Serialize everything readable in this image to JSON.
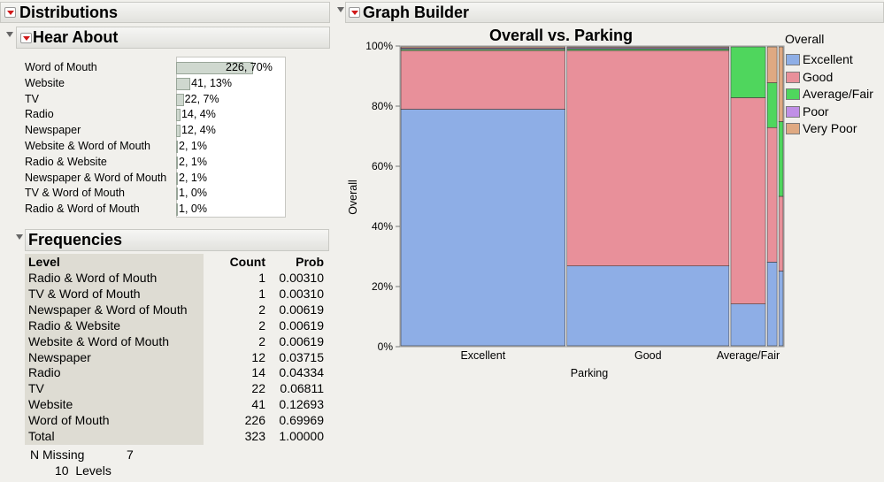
{
  "distributions": {
    "title": "Distributions"
  },
  "hear_about": {
    "title": "Hear About",
    "rows": [
      {
        "label": "Word of Mouth",
        "value": "226, 70%",
        "frac": 0.7
      },
      {
        "label": "Website",
        "value": "41, 13%",
        "frac": 0.13
      },
      {
        "label": "TV",
        "value": "22, 7%",
        "frac": 0.07
      },
      {
        "label": "Radio",
        "value": "14, 4%",
        "frac": 0.04
      },
      {
        "label": "Newspaper",
        "value": "12, 4%",
        "frac": 0.04
      },
      {
        "label": "Website & Word of Mouth",
        "value": "2, 1%",
        "frac": 0.01
      },
      {
        "label": "Radio & Website",
        "value": "2, 1%",
        "frac": 0.01
      },
      {
        "label": "Newspaper & Word of Mouth",
        "value": "2, 1%",
        "frac": 0.01
      },
      {
        "label": "TV & Word of Mouth",
        "value": "1, 0%",
        "frac": 0.0
      },
      {
        "label": "Radio & Word of Mouth",
        "value": "1, 0%",
        "frac": 0.0
      }
    ]
  },
  "frequencies": {
    "title": "Frequencies",
    "headers": {
      "level": "Level",
      "count": "Count",
      "prob": "Prob"
    },
    "rows": [
      {
        "level": "Radio & Word of Mouth",
        "count": "1",
        "prob": "0.00310"
      },
      {
        "level": "TV & Word of Mouth",
        "count": "1",
        "prob": "0.00310"
      },
      {
        "level": "Newspaper & Word of Mouth",
        "count": "2",
        "prob": "0.00619"
      },
      {
        "level": "Radio & Website",
        "count": "2",
        "prob": "0.00619"
      },
      {
        "level": "Website & Word of Mouth",
        "count": "2",
        "prob": "0.00619"
      },
      {
        "level": "Newspaper",
        "count": "12",
        "prob": "0.03715"
      },
      {
        "level": "Radio",
        "count": "14",
        "prob": "0.04334"
      },
      {
        "level": "TV",
        "count": "22",
        "prob": "0.06811"
      },
      {
        "level": "Website",
        "count": "41",
        "prob": "0.12693"
      },
      {
        "level": "Word of Mouth",
        "count": "226",
        "prob": "0.69969"
      },
      {
        "level": "Total",
        "count": "323",
        "prob": "1.00000"
      }
    ],
    "n_missing_label": "N Missing",
    "n_missing_value": "7",
    "levels_text": "10  Levels"
  },
  "graph_builder": {
    "title": "Graph Builder"
  },
  "chart_data": {
    "type": "mosaic",
    "title": "Overall vs. Parking",
    "xlabel": "Parking",
    "ylabel": "Overall",
    "y_ticks": [
      "0%",
      "20%",
      "40%",
      "60%",
      "80%",
      "100%"
    ],
    "x_categories": [
      "Excellent",
      "Good",
      "Average/Fair"
    ],
    "legend_title": "Overall",
    "legend": [
      {
        "name": "Excellent",
        "color": "#8eaee6"
      },
      {
        "name": "Good",
        "color": "#e8909a"
      },
      {
        "name": "Average/Fair",
        "color": "#4fd65d"
      },
      {
        "name": "Poor",
        "color": "#c08fe6"
      },
      {
        "name": "Very Poor",
        "color": "#dfa982"
      }
    ],
    "columns": [
      {
        "category": "Excellent",
        "width": 0.455,
        "segments": [
          0.785,
          0.195,
          0.004,
          0.004,
          0.004
        ]
      },
      {
        "category": "Good",
        "width": 0.449,
        "segments": [
          0.265,
          0.715,
          0.005,
          0.004,
          0.003
        ]
      },
      {
        "category": "Average/Fair",
        "width": 0.096,
        "segments": [
          0.14,
          0.69,
          0.17,
          0.0,
          0.0
        ]
      },
      {
        "category": "",
        "width": 0.027,
        "segments": [
          0.28,
          0.45,
          0.15,
          0.0,
          0.12
        ]
      },
      {
        "category": "",
        "width": 0.012,
        "segments": [
          0.25,
          0.25,
          0.25,
          0.0,
          0.25
        ]
      }
    ]
  }
}
